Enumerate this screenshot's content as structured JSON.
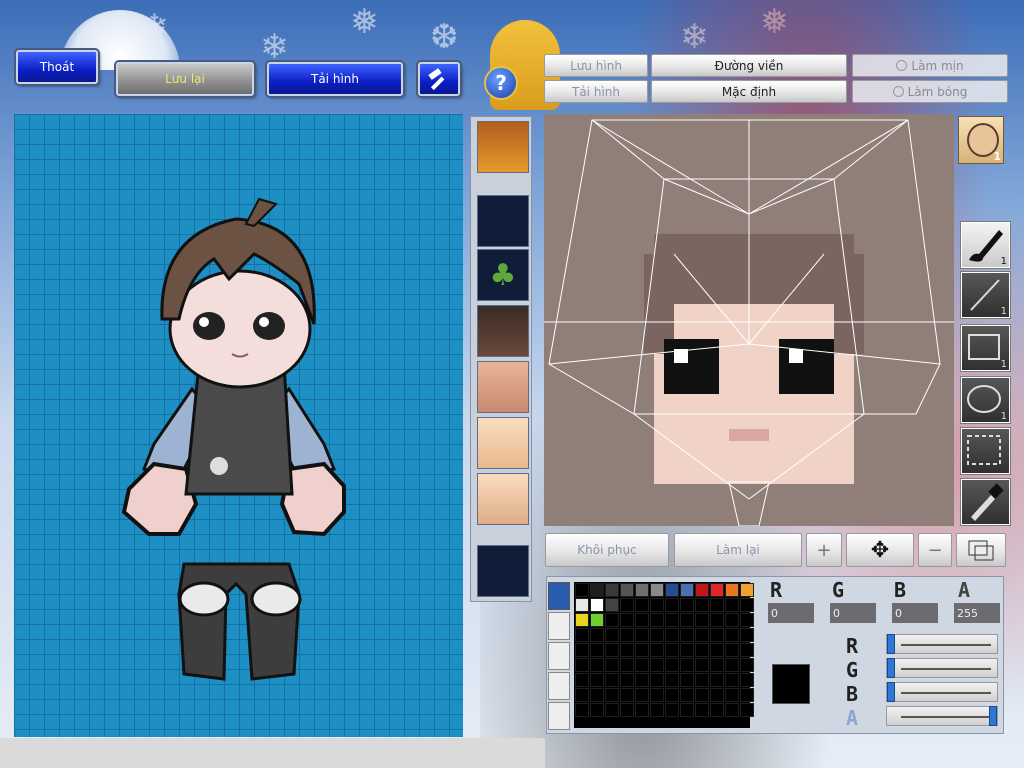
{
  "colors": {
    "canvas_bg": "#1e8fc4",
    "accent_blue": "#0b1fc4",
    "editor_bg": "#8f7f78"
  },
  "top_buttons": {
    "exit_label": "Thoát",
    "save_label": "Lưu lại",
    "reload_label": "Tải hình"
  },
  "icons": {
    "help": "question-mark-icon",
    "hammer": "hammer-icon"
  },
  "tabs": {
    "save_image": "Lưu hình",
    "load_image": "Tải hình",
    "outline": "Đường viền",
    "default": "Mặc định",
    "smooth": "Làm mịn",
    "shade": "Làm bóng"
  },
  "parts": [
    "hair-portrait",
    "empty",
    "tree",
    "armor",
    "face-eyes",
    "body",
    "face-mouth",
    "empty"
  ],
  "tools": [
    {
      "name": "brush-tool",
      "count": "1"
    },
    {
      "name": "line-tool",
      "count": "1"
    },
    {
      "name": "rectangle-tool",
      "count": "1"
    },
    {
      "name": "ellipse-tool",
      "count": "1"
    },
    {
      "name": "select-tool",
      "count": ""
    },
    {
      "name": "eyedropper-tool",
      "count": ""
    }
  ],
  "face_badge": {
    "count": "1"
  },
  "bottom_buttons": {
    "restore": "Khôi phục",
    "redo": "Làm lại"
  },
  "color_picker": {
    "labels": {
      "r": "R",
      "g": "G",
      "b": "B",
      "a": "A"
    },
    "values": {
      "r": "0",
      "g": "0",
      "b": "0",
      "a": "255"
    },
    "current_color": "#000000",
    "slider_levels": {
      "r": 0,
      "g": 0,
      "b": 0,
      "a": 1
    },
    "palette_row1": [
      "#000000",
      "#1e1e1e",
      "#3a3a3a",
      "#555555",
      "#6f6f6f",
      "#8a8a8a",
      "#254d8f",
      "#4c6fae",
      "#c01818",
      "#e02828",
      "#e8761c",
      "#f0a030"
    ],
    "palette_row2": [
      "#e8e8e8",
      "#ffffff",
      "#444444",
      "#000000",
      "#000000",
      "#000000",
      "#000000",
      "#000000",
      "#000000",
      "#000000",
      "#000000",
      "#000000"
    ],
    "palette_row3": [
      "#e8d41c",
      "#6fcf2c",
      "#000000",
      "#000000",
      "#000000",
      "#000000",
      "#000000",
      "#000000",
      "#000000",
      "#000000",
      "#000000",
      "#000000"
    ]
  }
}
